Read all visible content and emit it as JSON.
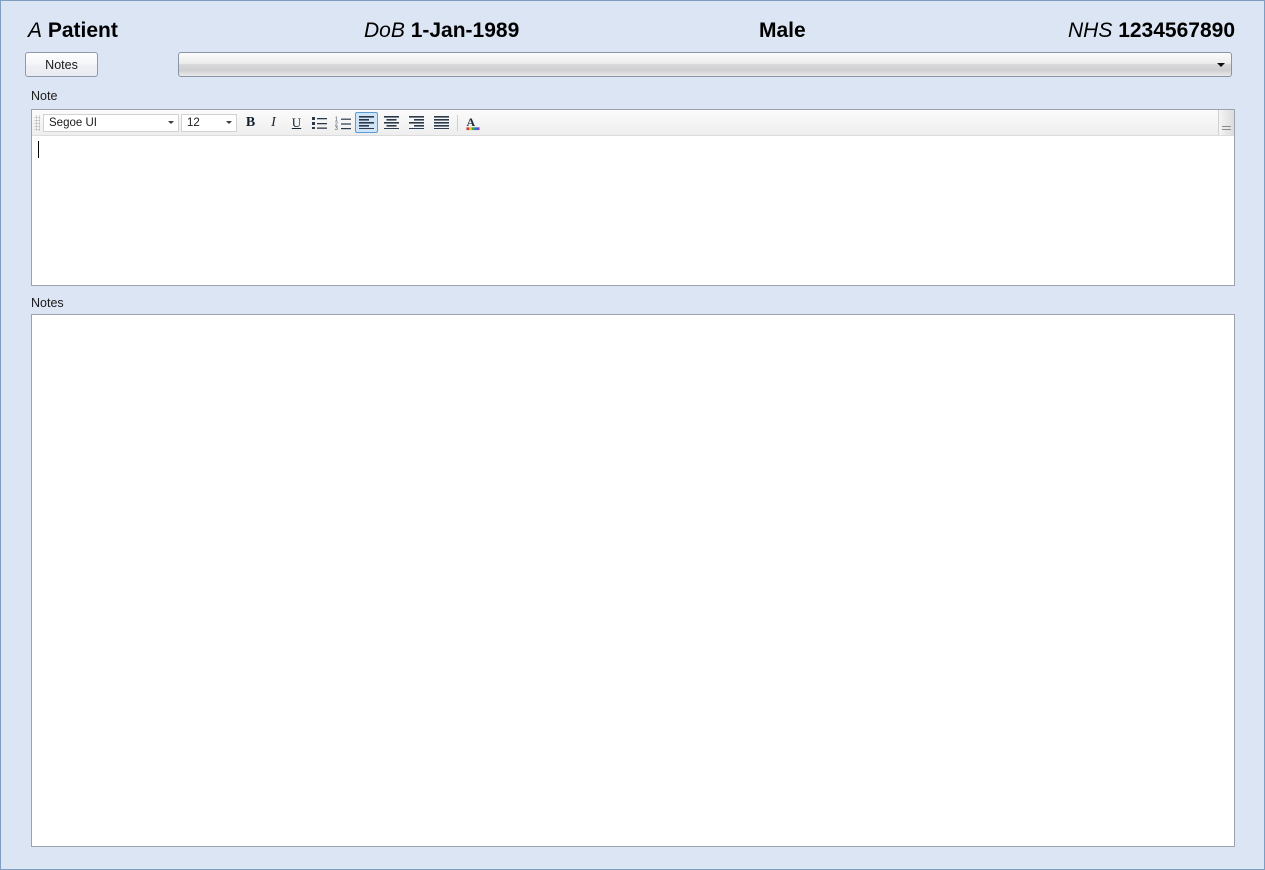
{
  "window": {
    "background_color": "#dbe5f4",
    "border_color": "#7f9dc1"
  },
  "patient_header": {
    "name_label": "A",
    "name_value": "Patient",
    "dob_label": "DoB",
    "dob_value": "1-Jan-1989",
    "sex_value": "Male",
    "nhs_label": "NHS",
    "nhs_value": "1234567890"
  },
  "toolbar": {
    "notes_button_label": "Notes",
    "note_select": {
      "value": "",
      "placeholder": "",
      "arrow_icon": "chevron-down-icon"
    }
  },
  "note_field": {
    "label": "Note",
    "content": "",
    "caret_visible": true,
    "editor_toolbar": {
      "grip_icon": "drag-grip-icon",
      "font_family": {
        "value": "Segoe UI",
        "arrow_icon": "chevron-down-icon"
      },
      "font_size": {
        "value": "12",
        "arrow_icon": "chevron-down-icon"
      },
      "buttons": [
        {
          "name": "bold-button",
          "glyph": "B",
          "icon": "bold-icon",
          "active": false
        },
        {
          "name": "italic-button",
          "glyph": "I",
          "icon": "italic-icon",
          "active": false
        },
        {
          "name": "underline-button",
          "glyph": "U",
          "icon": "underline-icon",
          "active": false
        },
        {
          "name": "bullet-list-button",
          "glyph": "",
          "icon": "bullet-list-icon",
          "active": false
        },
        {
          "name": "numbered-list-button",
          "glyph": "",
          "icon": "numbered-list-icon",
          "active": false
        },
        {
          "name": "align-left-button",
          "glyph": "",
          "icon": "align-left-icon",
          "active": true
        },
        {
          "name": "align-center-button",
          "glyph": "",
          "icon": "align-center-icon",
          "active": false
        },
        {
          "name": "align-right-button",
          "glyph": "",
          "icon": "align-right-icon",
          "active": false
        },
        {
          "name": "align-justify-button",
          "glyph": "",
          "icon": "align-justify-icon",
          "active": false
        },
        {
          "name": "font-color-button",
          "glyph": "A",
          "icon": "font-color-icon",
          "active": false
        }
      ],
      "active_highlight_color": "#cfe4f7",
      "active_border_color": "#5c9cd6",
      "scroll_handle_icon": "scroll-grip-icon"
    }
  },
  "notes_list": {
    "label": "Notes",
    "items": [],
    "empty": true
  }
}
